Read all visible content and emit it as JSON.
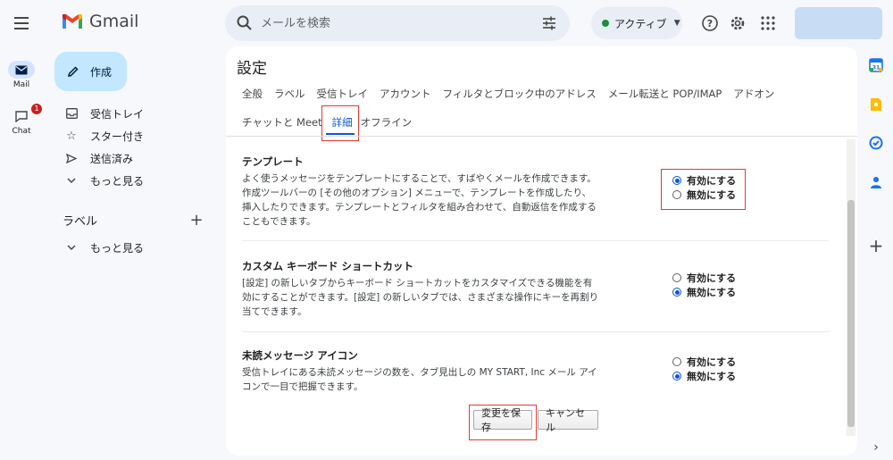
{
  "app": {
    "name": "Gmail"
  },
  "search": {
    "placeholder": "メールを検索"
  },
  "status": {
    "label": "アクティブ"
  },
  "rail": {
    "mail_label": "Mail",
    "chat_label": "Chat",
    "chat_badge": "1"
  },
  "nav": {
    "compose": "作成",
    "items": [
      {
        "label": "受信トレイ",
        "icon": "inbox-icon"
      },
      {
        "label": "スター付き",
        "icon": "star-icon"
      },
      {
        "label": "送信済み",
        "icon": "send-icon"
      },
      {
        "label": "もっと見る",
        "icon": "chevron-down-icon"
      }
    ],
    "labels_heading": "ラベル",
    "labels_more": "もっと見る"
  },
  "settings": {
    "title": "設定",
    "tabs_row1": [
      "全般",
      "ラベル",
      "受信トレイ",
      "アカウント",
      "フィルタとブロック中のアドレス",
      "メール転送と POP/IMAP",
      "アドオン"
    ],
    "tabs_row2": [
      "チャットと Meet",
      "詳細",
      "オフライン"
    ],
    "active_tab": "詳細",
    "sections": [
      {
        "title": "テンプレート",
        "desc_lines": [
          "よく使うメッセージをテンプレートにすることで、すばやくメールを作成できます。",
          "作成ツールバーの [その他のオプション] メニューで、テンプレートを作成したり、",
          "挿入したりできます。テンプレートとフィルタを組み合わせて、自動返信を作成する",
          "こともできます。"
        ],
        "options": [
          "有効にする",
          "無効にする"
        ],
        "selected": "有効にする"
      },
      {
        "title": "カスタム キーボード ショートカット",
        "desc_lines": [
          "[設定] の新しいタブからキーボード ショートカットをカスタマイズできる機能を有",
          "効にすることができます。[設定] の新しいタブでは、さまざまな操作にキーを再割り",
          "当てできます。"
        ],
        "options": [
          "有効にする",
          "無効にする"
        ],
        "selected": "無効にする"
      },
      {
        "title": "未読メッセージ アイコン",
        "desc_lines": [
          "受信トレイにある未読メッセージの数を、タブ見出しの MY START, Inc メール アイ",
          "コンで一目で把握できます。"
        ],
        "options": [
          "有効にする",
          "無効にする"
        ],
        "selected": "無効にする"
      }
    ],
    "save_label": "変更を保存",
    "cancel_label": "キャンセル"
  },
  "colors": {
    "accent": "#0b57d0",
    "highlight": "#e53935",
    "compose_bg": "#c2e7ff",
    "active_status": "#1e8e3e"
  }
}
